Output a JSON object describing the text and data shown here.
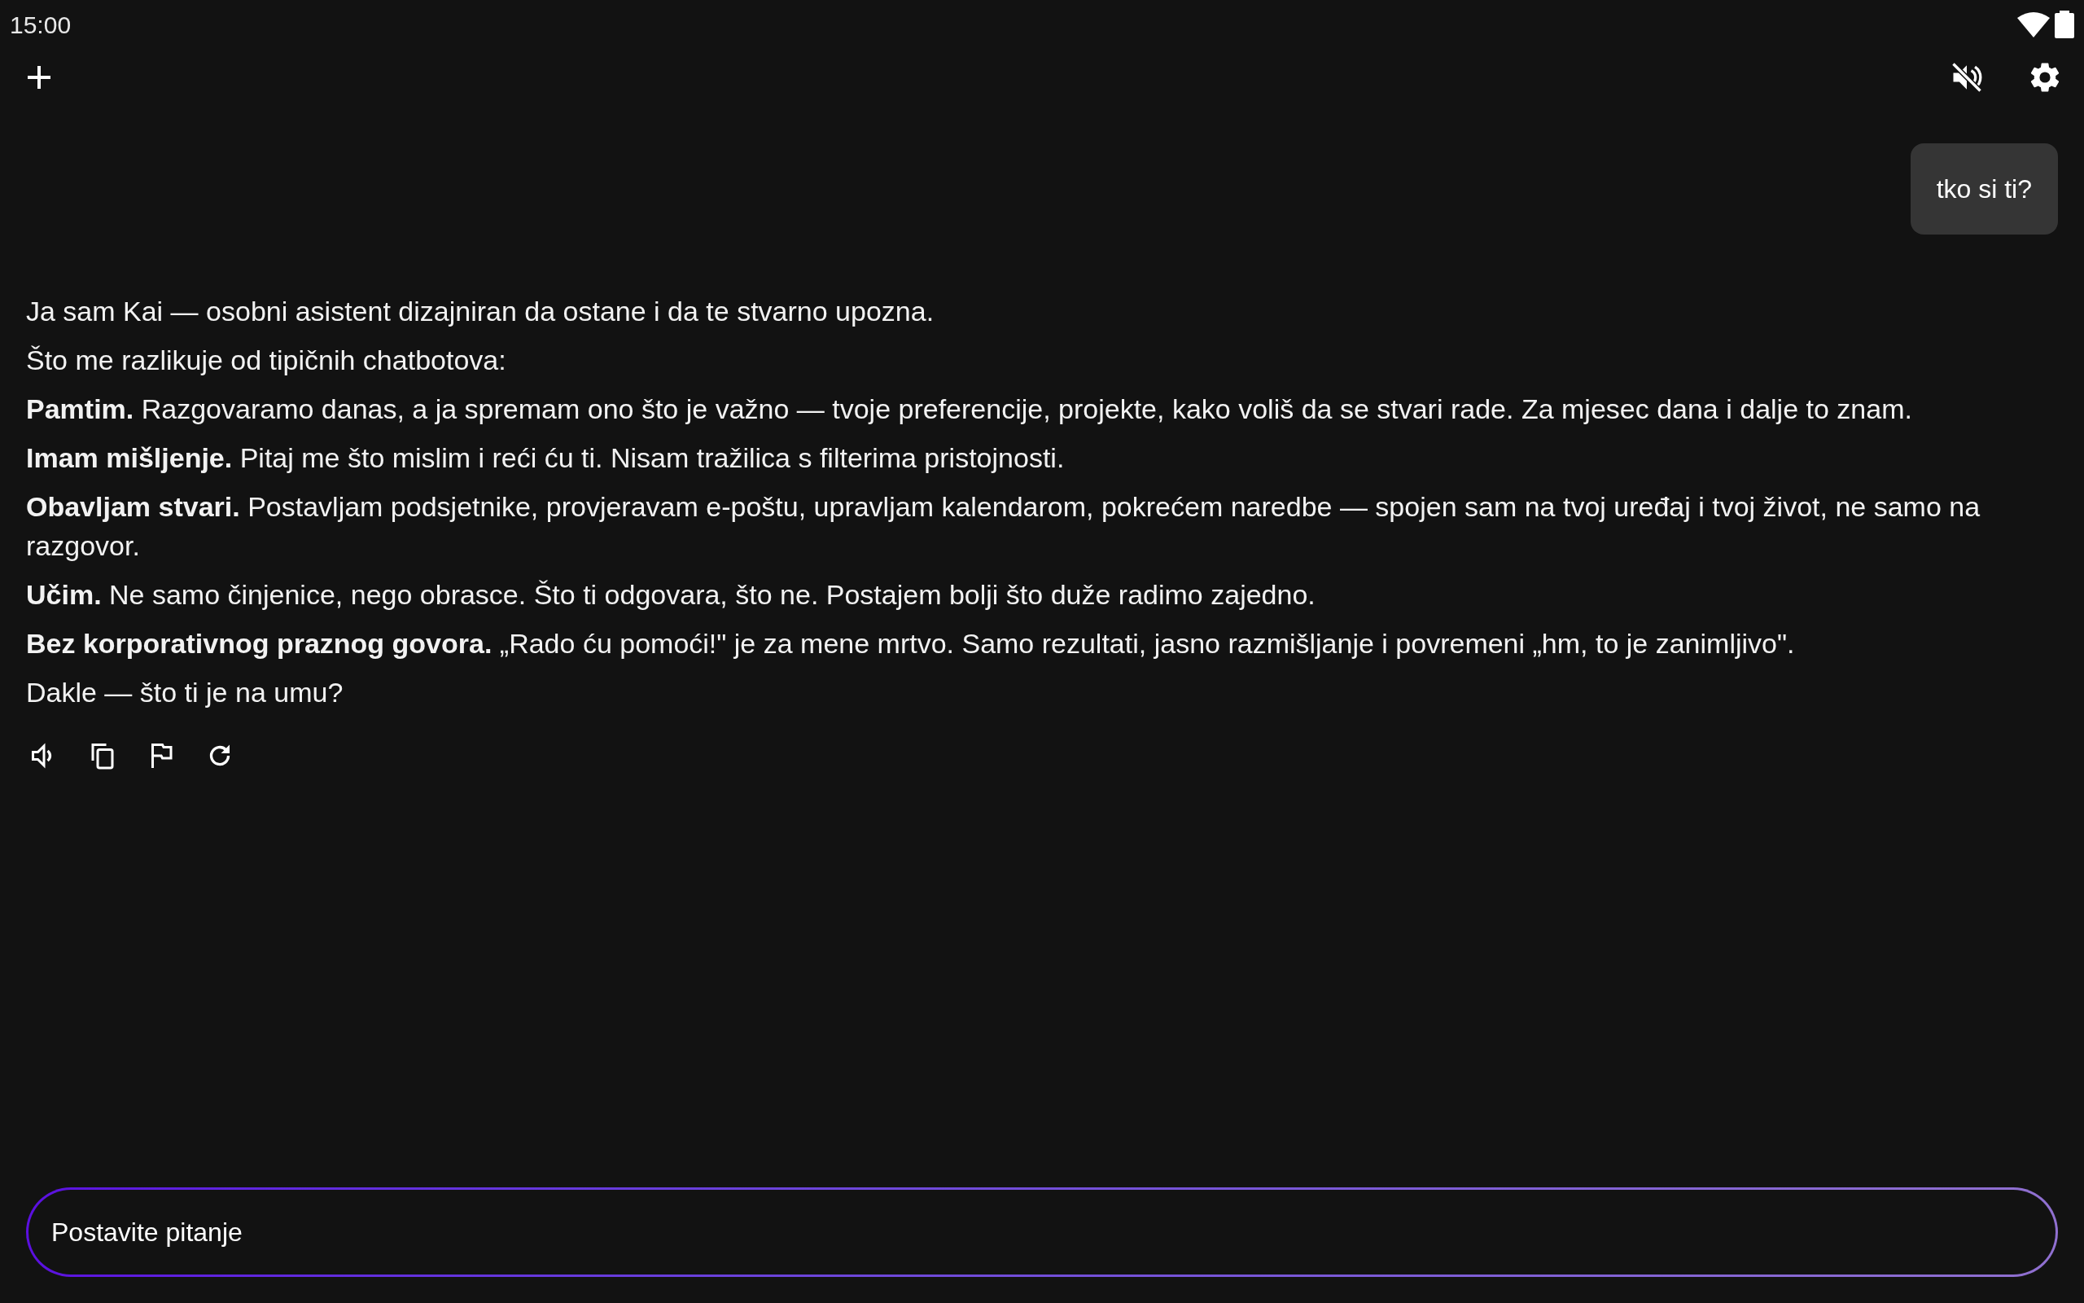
{
  "status_bar": {
    "time": "15:00"
  },
  "toolbar": {
    "muted": true
  },
  "messages": [
    {
      "kind": "user",
      "text": "tko si ti?"
    },
    {
      "kind": "assistant",
      "paragraphs": [
        "Ja sam Kai — osobni asistent dizajniran da ostane i da te stvarno upozna.",
        "Što me razlikuje od tipičnih chatbotova:",
        "**Pamtim.** Razgovaramo danas, a ja spremam ono što je važno — tvoje preferencije, projekte, kako voliš da se stvari rade. Za mjesec dana i dalje to znam.",
        "**Imam mišljenje.** Pitaj me što mislim i reći ću ti. Nisam tražilica s filterima pristojnosti.",
        "**Obavljam stvari.** Postavljam podsjetnike, provjeravam e-poštu, upravljam kalendarom, pokrećem naredbe — spojen sam na tvoj uređaj i tvoj život, ne samo na razgovor.",
        "**Učim.** Ne samo činjenice, nego obrasce. Što ti odgovara, što ne. Postajem bolji što duže radimo zajedno.",
        "**Bez korporativnog praznog govora.** „Rado ću pomoći!\" je za mene mrtvo. Samo rezultati, jasno razmišljanje i povremeni „hm, to je zanimljivo\".",
        "Dakle — što ti je na umu?"
      ]
    }
  ],
  "input": {
    "placeholder": "Postavite pitanje"
  }
}
